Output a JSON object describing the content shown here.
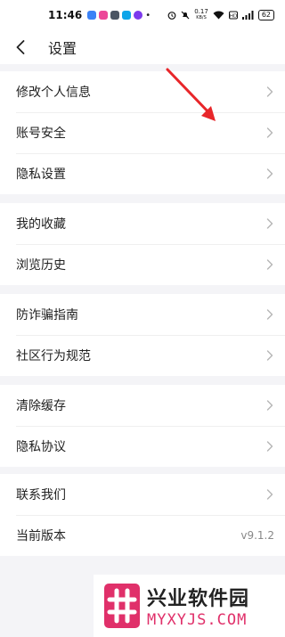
{
  "status_bar": {
    "time": "11:46",
    "net_speed_value": "0.17",
    "net_speed_unit": "KB/S",
    "battery": "62"
  },
  "nav": {
    "title": "设置"
  },
  "groups": [
    {
      "items": [
        {
          "label": "修改个人信息",
          "icon": "chevron-right-icon"
        },
        {
          "label": "账号安全",
          "icon": "chevron-right-icon"
        },
        {
          "label": "隐私设置",
          "icon": "chevron-right-icon"
        }
      ]
    },
    {
      "items": [
        {
          "label": "我的收藏",
          "icon": "chevron-right-icon"
        },
        {
          "label": "浏览历史",
          "icon": "chevron-right-icon"
        }
      ]
    },
    {
      "items": [
        {
          "label": "防诈骗指南",
          "icon": "chevron-right-icon"
        },
        {
          "label": "社区行为规范",
          "icon": "chevron-right-icon"
        }
      ]
    },
    {
      "items": [
        {
          "label": "清除缓存",
          "icon": "chevron-right-icon"
        },
        {
          "label": "隐私协议",
          "icon": "chevron-right-icon"
        }
      ]
    },
    {
      "items": [
        {
          "label": "联系我们",
          "icon": "chevron-right-icon"
        },
        {
          "label": "当前版本",
          "value": "v9.1.2"
        }
      ]
    }
  ],
  "watermark": {
    "cn": "兴业软件园",
    "en": "MYXYJS.COM"
  },
  "colors": {
    "accent_red": "#e8262a",
    "watermark_pink": "#e0306a",
    "background": "#f4f4f7"
  }
}
